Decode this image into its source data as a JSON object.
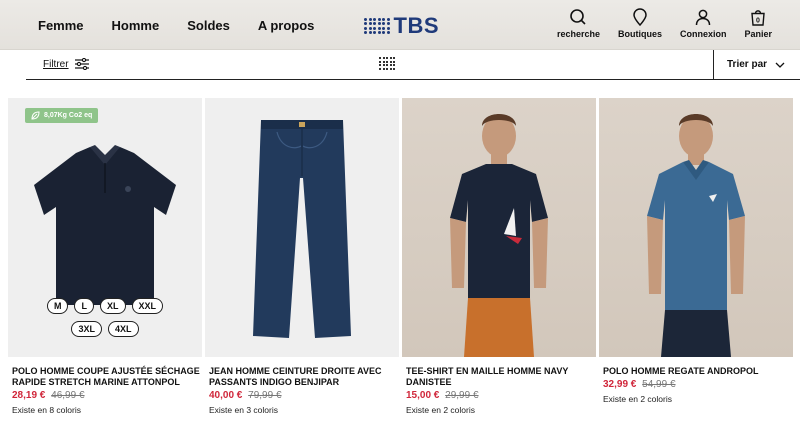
{
  "nav": {
    "items": [
      "Femme",
      "Homme",
      "Soldes",
      "A propos"
    ],
    "logo_text": "TBS"
  },
  "tools": [
    {
      "label": "recherche",
      "icon": "search-icon"
    },
    {
      "label": "Boutiques",
      "icon": "map-pin-icon"
    },
    {
      "label": "Connexion",
      "icon": "user-icon"
    },
    {
      "label": "Panier",
      "icon": "bag-icon",
      "count": "0"
    }
  ],
  "filterbar": {
    "filter_label": "Filtrer",
    "sort_label": "Trier par"
  },
  "colors": {
    "brand": "#1f3a7a",
    "sale_price": "#d0263a",
    "eco_badge": "#8fc48a"
  },
  "products": [
    {
      "name": "POLO HOMME COUPE AJUSTÉE SÉCHAGE RAPIDE STRETCH MARINE ATTONPOL",
      "price": "28,19 €",
      "old_price": "46,99 €",
      "colors_text": "Existe en 8 coloris",
      "badge": "8,07Kg Co2 eq",
      "sizes_row1": [
        "M",
        "L",
        "XL",
        "XXL"
      ],
      "sizes_row2": [
        "3XL",
        "4XL"
      ]
    },
    {
      "name": "JEAN HOMME CEINTURE DROITE AVEC PASSANTS INDIGO BENJIPAR",
      "price": "40,00 €",
      "old_price": "79,99 €",
      "colors_text": "Existe en 3 coloris"
    },
    {
      "name": "TEE-SHIRT EN MAILLE HOMME NAVY DANISTEE",
      "price": "15,00 €",
      "old_price": "29,99 €",
      "colors_text": "Existe en 2 coloris"
    },
    {
      "name": "POLO HOMME REGATE ANDROPOL",
      "price": "32,99 €",
      "old_price": "54,99 €",
      "colors_text": "Existe en 2 coloris"
    }
  ]
}
